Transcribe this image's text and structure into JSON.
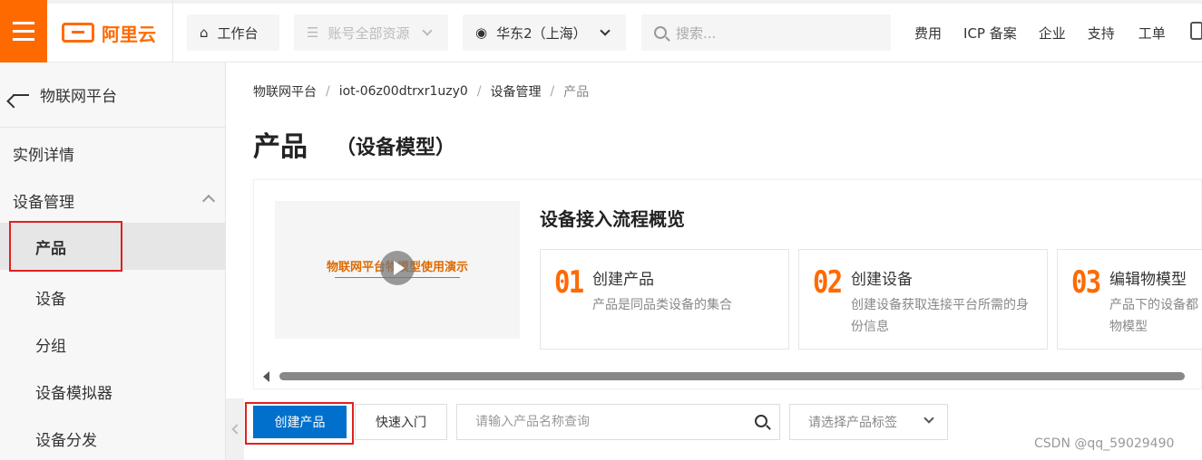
{
  "topbar": {
    "logo_text": "阿里云",
    "workbench": "工作台",
    "account_resources": "账号全部资源",
    "region": "华东2（上海）",
    "search_placeholder": "搜索...",
    "links": [
      "费用",
      "ICP 备案",
      "企业",
      "支持",
      "工单"
    ]
  },
  "sidebar": {
    "back_label": "物联网平台",
    "items": [
      {
        "label": "实例详情"
      },
      {
        "label": "设备管理"
      },
      {
        "label": "产品"
      },
      {
        "label": "设备"
      },
      {
        "label": "分组"
      },
      {
        "label": "设备模拟器"
      },
      {
        "label": "设备分发"
      }
    ]
  },
  "breadcrumb": [
    "物联网平台",
    "iot-06z00dtrxr1uzy0",
    "设备管理",
    "产品"
  ],
  "breadcrumb_sep": "/",
  "page": {
    "title": "产品",
    "subtitle": "（设备模型）"
  },
  "overview": {
    "video_title": "物联网平台物模型使用演示",
    "title": "设备接入流程概览",
    "steps": [
      {
        "num": "01",
        "title": "创建产品",
        "desc": "产品是同品类设备的集合"
      },
      {
        "num": "02",
        "title": "创建设备",
        "desc": "创建设备获取连接平台所需的身份信息"
      },
      {
        "num": "03",
        "title": "编辑物模型",
        "desc": "产品下的设备都物模型"
      }
    ]
  },
  "toolbar": {
    "create_label": "创建产品",
    "quickstart_label": "快速入门",
    "search_placeholder": "请输入产品名称查询",
    "tag_placeholder": "请选择产品标签"
  },
  "watermark": "CSDN @qq_59029490",
  "colors": {
    "brand": "#ff6a00",
    "primary": "#0070cc",
    "highlight": "#e02020"
  }
}
